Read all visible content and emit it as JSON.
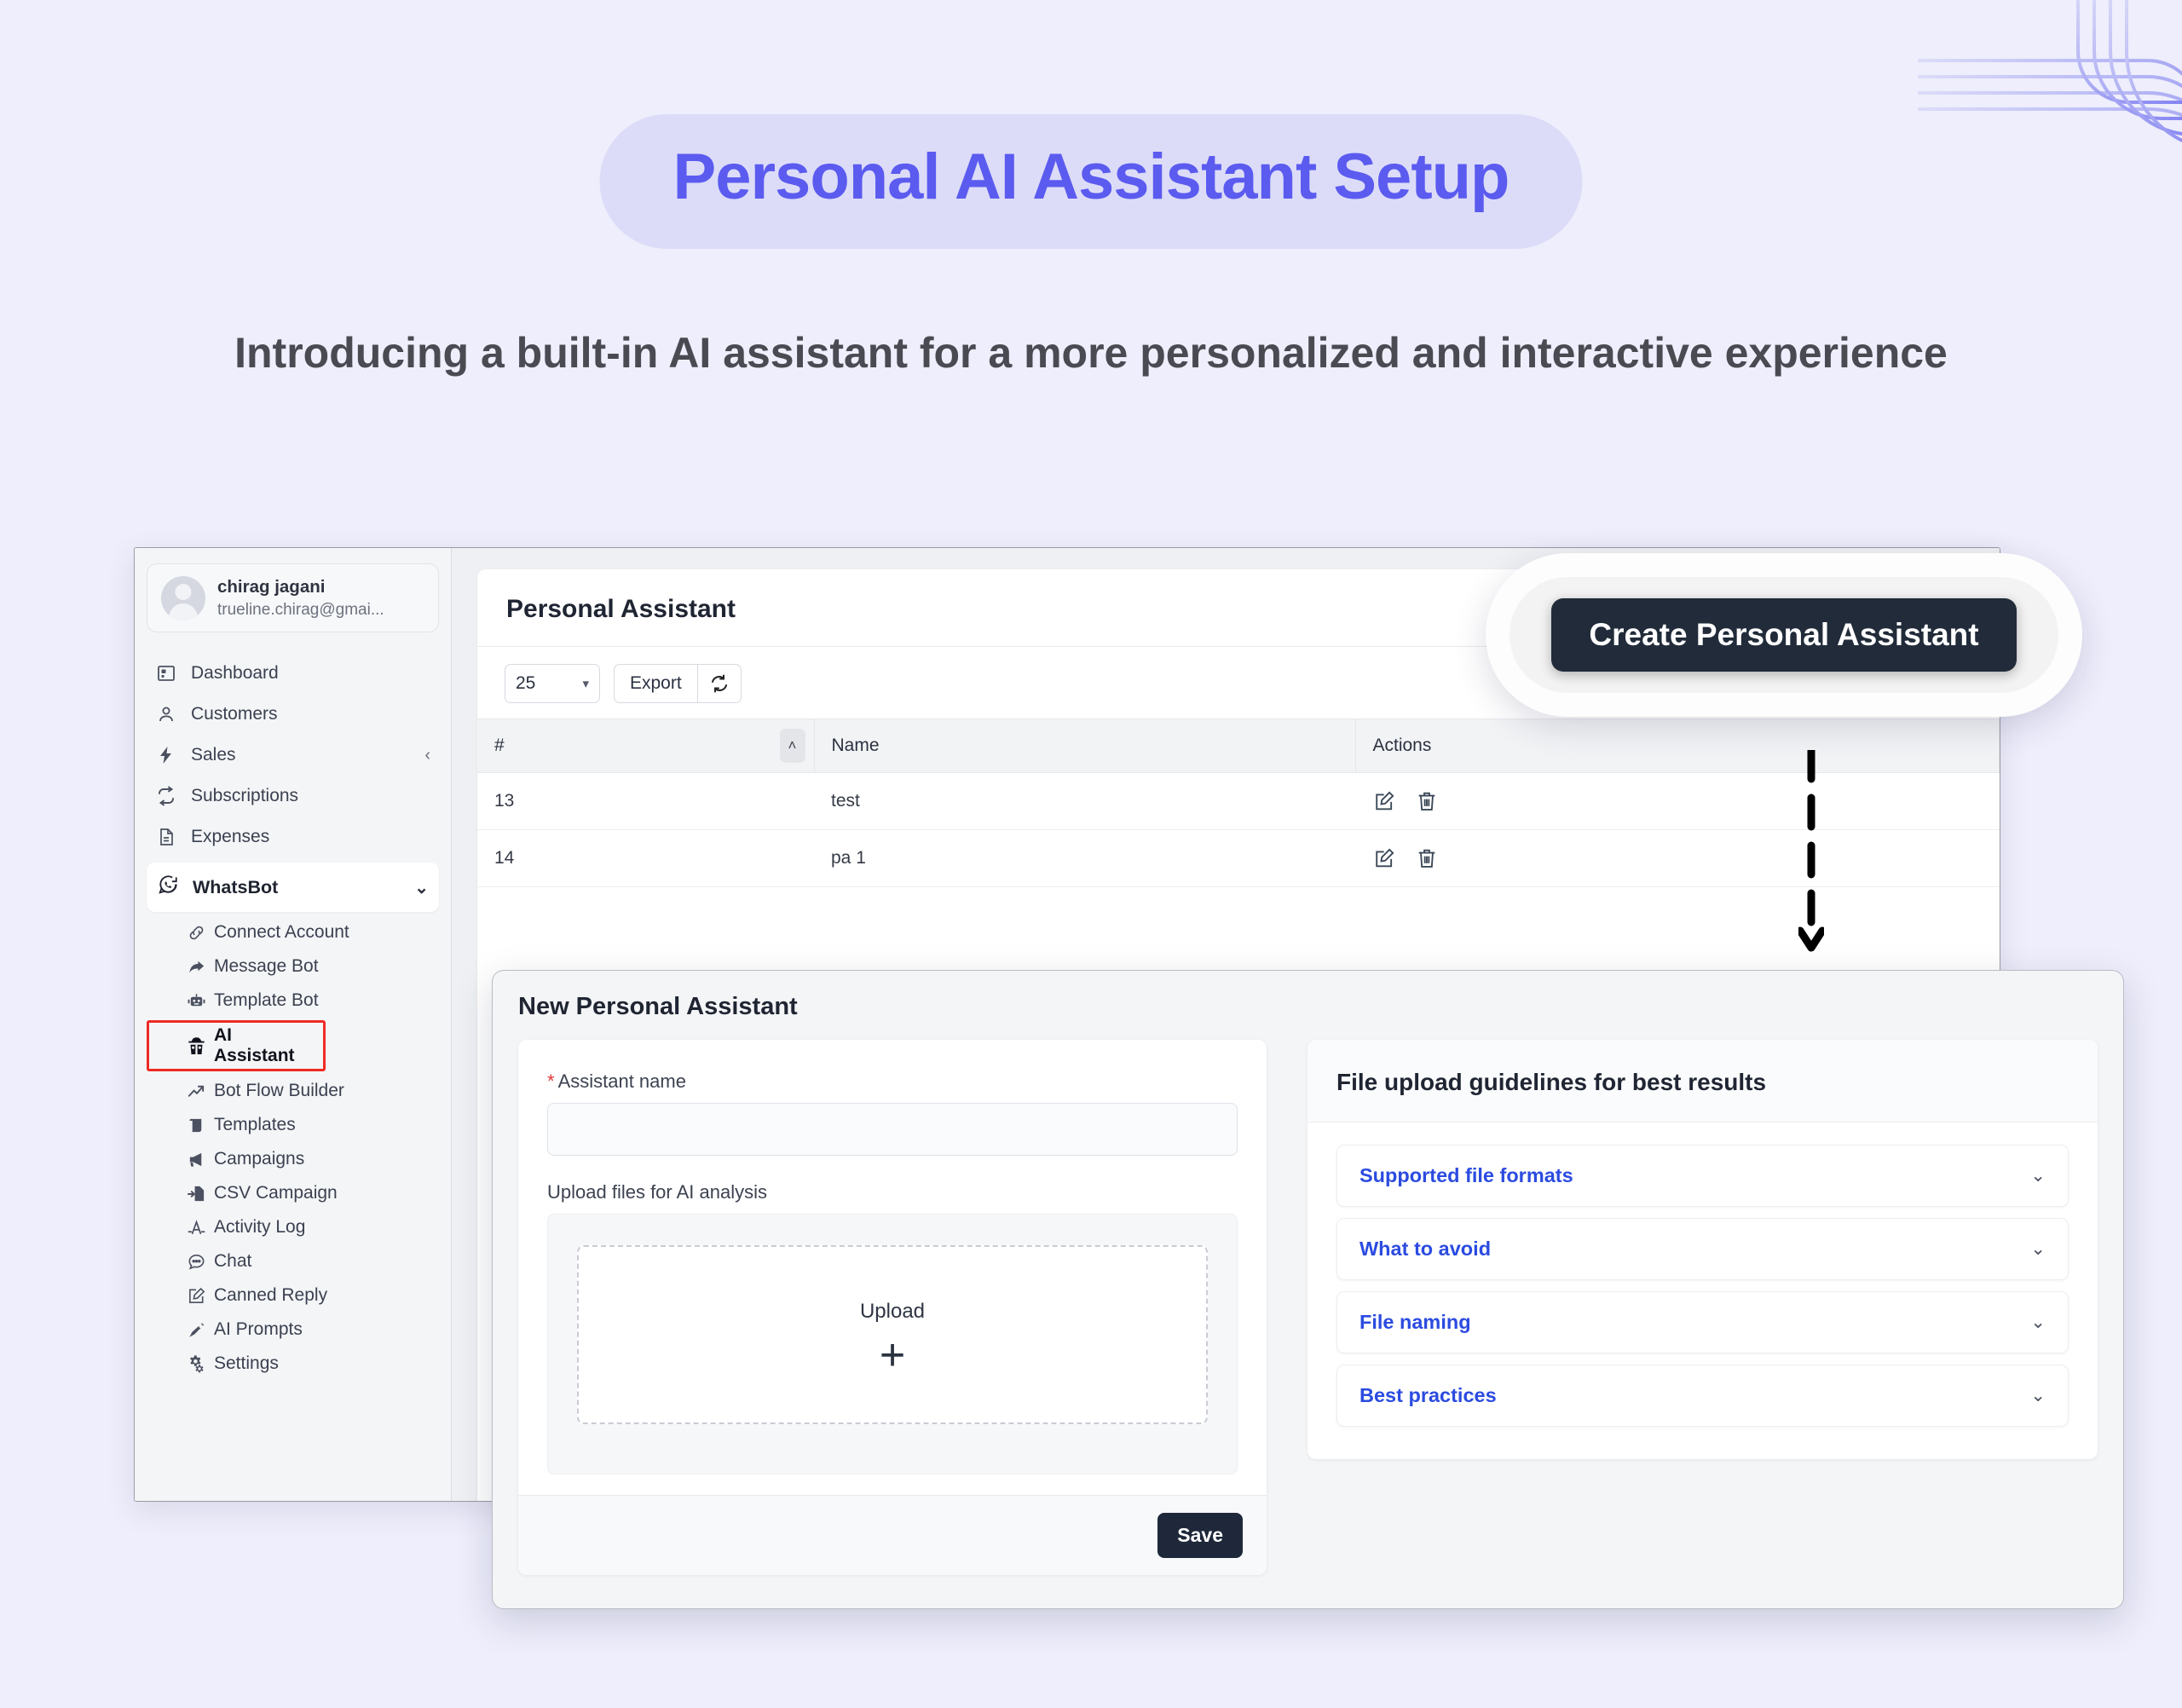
{
  "header": {
    "title": "Personal AI Assistant Setup",
    "subtitle": "Introducing a built-in AI assistant for a more personalized and interactive experience",
    "accent_color": "#5b5bf0",
    "pill_color": "#dcdcf8",
    "page_background": "#eeeefc"
  },
  "sidebar": {
    "user": {
      "name": "chirag jagani",
      "email": "trueline.chirag@gmai..."
    },
    "items": [
      {
        "label": "Dashboard",
        "icon": "dashboard-icon"
      },
      {
        "label": "Customers",
        "icon": "user-icon"
      },
      {
        "label": "Sales",
        "icon": "bolt-icon",
        "chevron": "‹"
      },
      {
        "label": "Subscriptions",
        "icon": "recurring-icon"
      },
      {
        "label": "Expenses",
        "icon": "document-icon"
      }
    ],
    "group": {
      "label": "WhatsBot",
      "icon": "whatsapp-icon",
      "chevron": "⌄",
      "sub_items": [
        {
          "label": "Connect Account",
          "icon": "link-icon",
          "active": false
        },
        {
          "label": "Message Bot",
          "icon": "forward-arrow-icon",
          "active": false
        },
        {
          "label": "Template Bot",
          "icon": "robot-icon",
          "active": false
        },
        {
          "label": "AI Assistant",
          "icon": "spy-icon",
          "active": true
        },
        {
          "label": "Bot Flow Builder",
          "icon": "trending-up-icon",
          "active": false
        },
        {
          "label": "Templates",
          "icon": "scroll-icon",
          "active": false
        },
        {
          "label": "Campaigns",
          "icon": "megaphone-icon",
          "active": false
        },
        {
          "label": "CSV Campaign",
          "icon": "csv-import-icon",
          "active": false
        },
        {
          "label": "Activity Log",
          "icon": "activity-icon",
          "active": false
        },
        {
          "label": "Chat",
          "icon": "chat-bubble-icon",
          "active": false
        },
        {
          "label": "Canned Reply",
          "icon": "edit-square-icon",
          "active": false
        },
        {
          "label": "AI Prompts",
          "icon": "pen-nib-icon",
          "active": false
        },
        {
          "label": "Settings",
          "icon": "gears-icon",
          "active": false
        }
      ]
    },
    "active_highlight_color": "#ef2a25"
  },
  "main": {
    "page_title": "Personal Assistant",
    "toolbar": {
      "page_size": "25",
      "page_size_options": [
        "25"
      ],
      "export_label": "Export",
      "refresh_icon": "refresh-icon"
    },
    "table": {
      "columns": [
        "#",
        "Name",
        "Actions"
      ],
      "sort_indicator": "˄",
      "rows": [
        {
          "num": "13",
          "name": "test",
          "actions": [
            "edit-icon",
            "delete-icon"
          ]
        },
        {
          "num": "14",
          "name": "pa 1",
          "actions": [
            "edit-icon",
            "delete-icon"
          ]
        }
      ]
    }
  },
  "callout": {
    "button_label": "Create Personal Assistant",
    "button_color": "#212b3a"
  },
  "form": {
    "title": "New Personal Assistant",
    "assistant_name": {
      "required_marker": "*",
      "label": "Assistant name",
      "value": "",
      "placeholder": ""
    },
    "upload": {
      "label": "Upload files for AI analysis",
      "dropzone_text": "Upload",
      "dropzone_plus": "+"
    },
    "save_label": "Save",
    "guidelines": {
      "title": "File upload guidelines for best results",
      "items": [
        {
          "label": "Supported file formats",
          "chevron": "⌄"
        },
        {
          "label": "What to avoid",
          "chevron": "⌄"
        },
        {
          "label": "File naming",
          "chevron": "⌄"
        },
        {
          "label": "Best practices",
          "chevron": "⌄"
        }
      ],
      "link_color": "#2b4be0"
    }
  }
}
